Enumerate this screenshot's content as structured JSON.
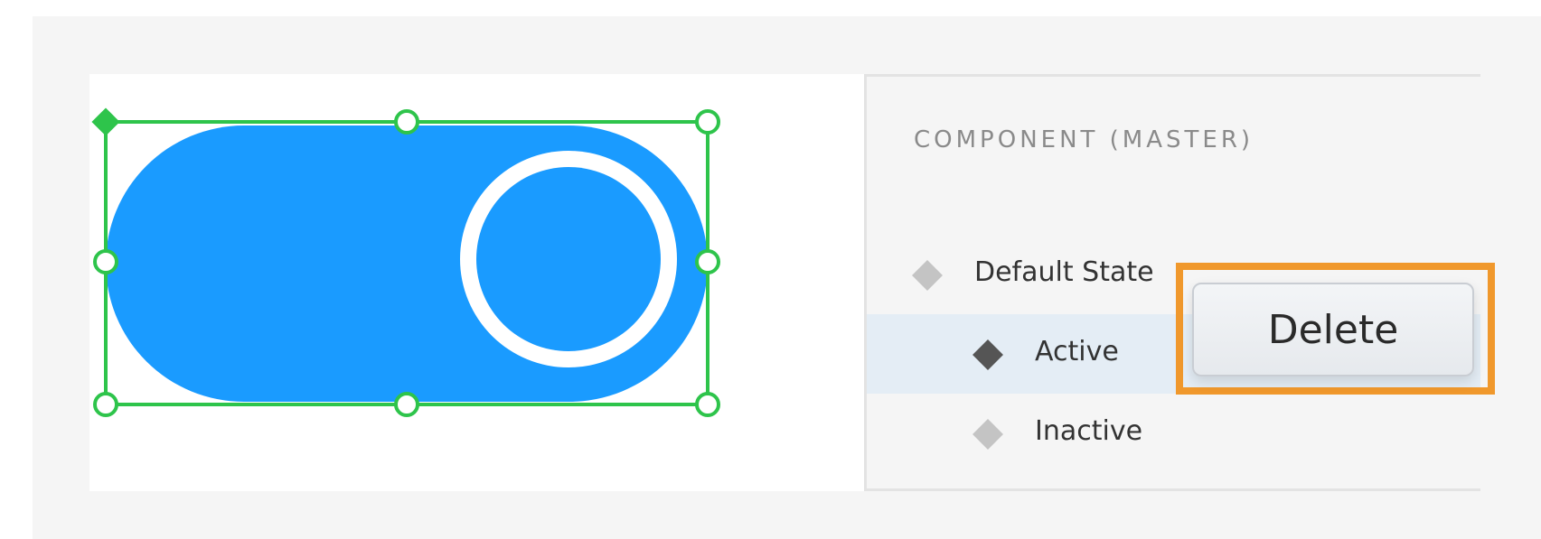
{
  "panel": {
    "title": "COMPONENT (MASTER)",
    "states": [
      {
        "label": "Default State",
        "selected": false
      },
      {
        "label": "Active",
        "selected": true
      },
      {
        "label": "Inactive",
        "selected": false
      }
    ]
  },
  "context_menu": {
    "delete_label": "Delete"
  },
  "colors": {
    "toggle_fill": "#1a9bff",
    "selection": "#2ec44b",
    "highlight_box": "#f0982c",
    "selected_row": "#e4edf5"
  },
  "icons": {
    "state": "diamond-icon",
    "resize_handle": "circle-handle",
    "anchor": "diamond-anchor"
  }
}
